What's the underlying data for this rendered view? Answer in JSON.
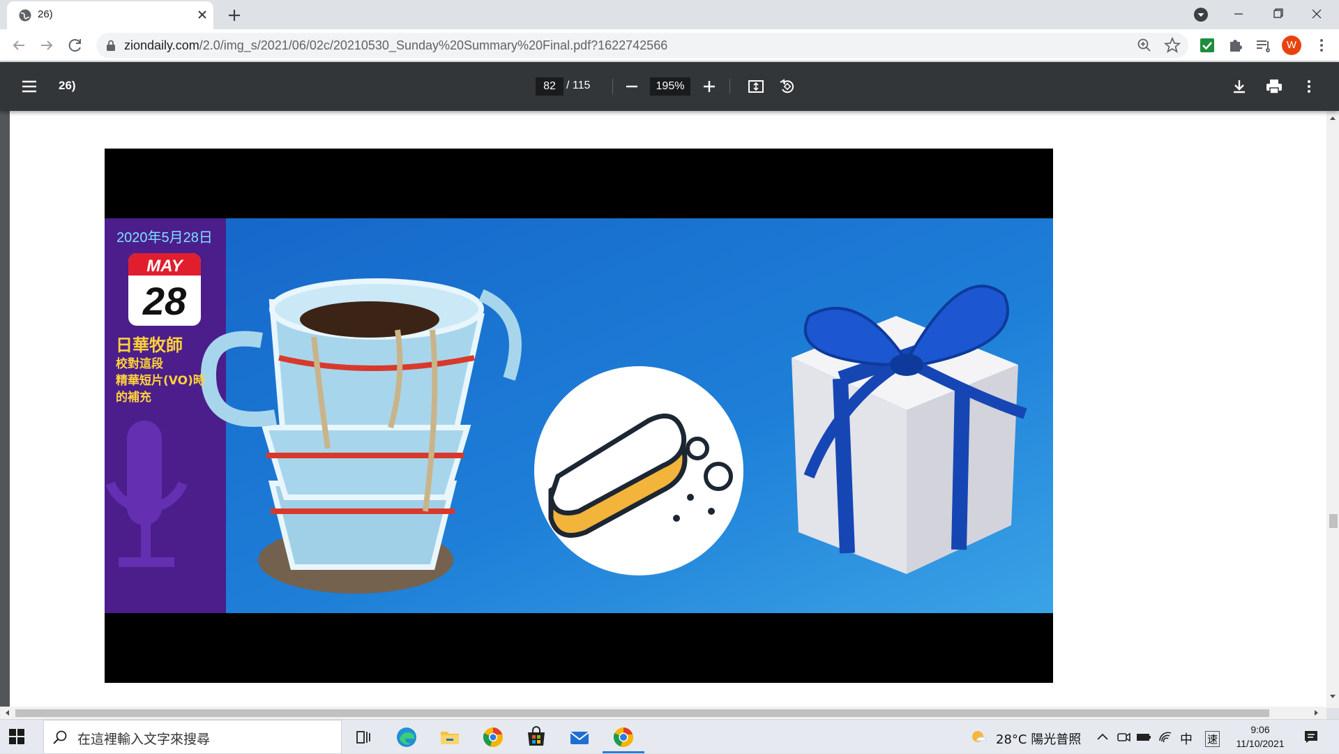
{
  "browser": {
    "tab_title": "26)",
    "url_host": "ziondaily.com",
    "url_path": "/2.0/img_s/2021/06/02c/20210530_Sunday%20Summary%20Final.pdf?1622742566",
    "profile_initial": "W"
  },
  "pdf": {
    "title": "26)",
    "current_page": "82",
    "total_pages": "/ 115",
    "zoom": "195%"
  },
  "slide": {
    "date_text": "2020年5月28日",
    "calendar_month": "MAY",
    "calendar_day": "28",
    "caption_line1": "日華牧師",
    "caption_line2": "校對這段",
    "caption_line3": "精華短片(VO)時",
    "caption_line4": "的補充"
  },
  "taskbar": {
    "search_placeholder": "在這裡輸入文字來搜尋",
    "weather": "28°C 陽光普照",
    "ime_lang": "中",
    "ime_mode": "速",
    "time": "9:06",
    "date": "11/10/2021"
  },
  "colors": {
    "pdf_toolbar": "#323639",
    "slide_blue": "#1e7fd8",
    "slide_purple": "#4b1e8c",
    "taskbar_bg": "#e6eaf0",
    "avatar": "#e8430e"
  }
}
